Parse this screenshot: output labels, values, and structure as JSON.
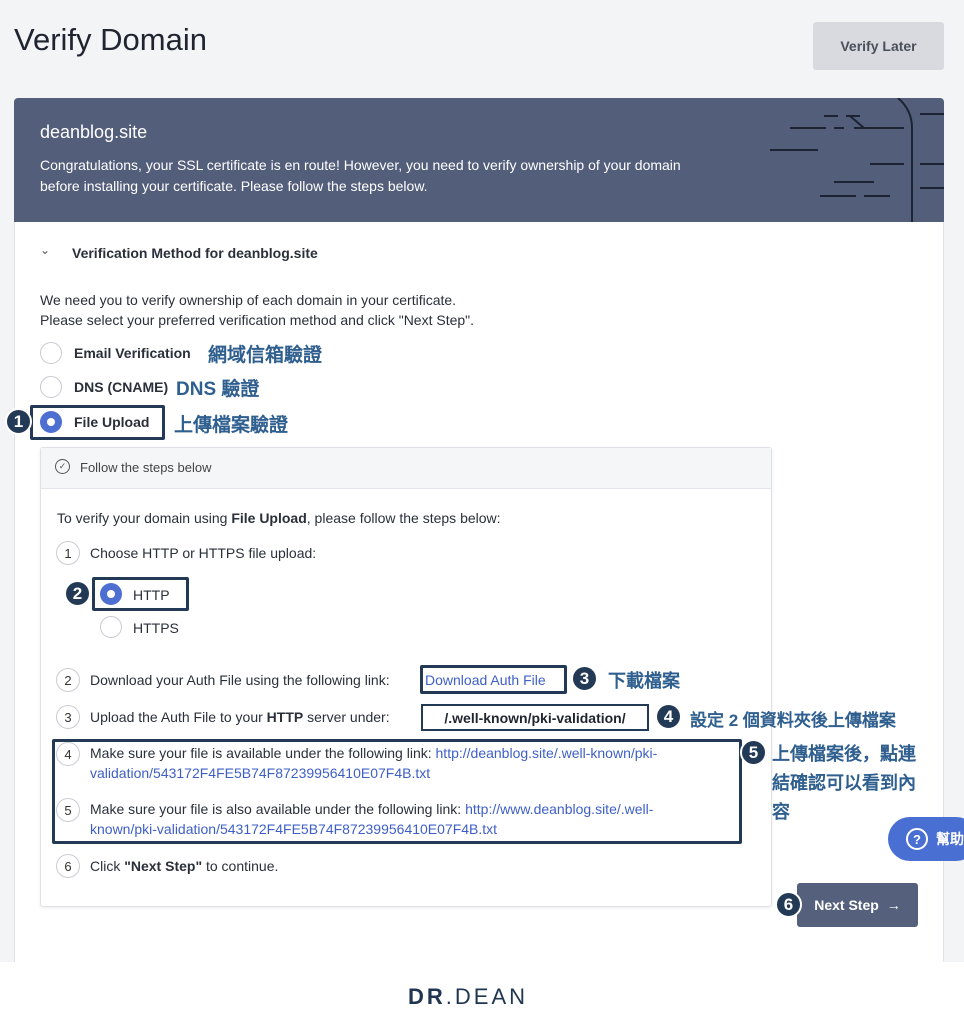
{
  "header": {
    "title": "Verify Domain",
    "verify_later": "Verify Later"
  },
  "banner": {
    "domain": "deanblog.site",
    "message": "Congratulations, your SSL certificate is en route! However, you need to verify ownership of your domain before installing your certificate. Please follow the steps below."
  },
  "method": {
    "title": "Verification Method for deanblog.site",
    "intro_line1": "We need you to verify ownership of each domain in your certificate.",
    "intro_line2": "Please select your preferred verification method and click \"Next Step\".",
    "options": [
      {
        "label": "Email Verification",
        "annotation": "網域信箱驗證",
        "selected": false
      },
      {
        "label": "DNS (CNAME)",
        "annotation": "DNS 驗證",
        "selected": false
      },
      {
        "label": "File Upload",
        "annotation": "上傳檔案驗證",
        "selected": true
      }
    ]
  },
  "steps": {
    "header": "Follow the steps below",
    "intro_prefix": "To verify your domain using ",
    "intro_bold": "File Upload",
    "intro_suffix": ", please follow the steps below:",
    "step1": {
      "num": "1",
      "text": "Choose HTTP or HTTPS file upload:",
      "http": "HTTP",
      "https": "HTTPS"
    },
    "step2": {
      "num": "2",
      "text": "Download your Auth File using the following link:",
      "link": "Download Auth File",
      "annotation": "下載檔案"
    },
    "step3": {
      "num": "3",
      "prefix": "Upload the Auth File to your ",
      "bold": "HTTP",
      "suffix": " server under:",
      "path": "/.well-known/pki-validation/",
      "annotation": "設定 2 個資料夾後上傳檔案"
    },
    "step4": {
      "num": "4",
      "text": "Make sure your file is available under the following link:",
      "link_a": "http://deanblog.site/.well-known/pki-",
      "link_b": "validation/543172F4FE5B74F87239956410E07F4B.txt"
    },
    "step5": {
      "num": "5",
      "text": "Make sure your file is also available under the following link:",
      "link_a": "http://www.deanblog.site/.well-",
      "link_b": "known/pki-validation/543172F4FE5B74F87239956410E07F4B.txt"
    },
    "step6": {
      "num": "6",
      "prefix": "Click ",
      "bold": "\"Next Step\"",
      "suffix": " to continue."
    },
    "annotation5_line1": "上傳檔案後，點連",
    "annotation5_line2": "結確認可以看到內",
    "annotation5_line3": "容"
  },
  "badges": [
    "1",
    "2",
    "3",
    "4",
    "5",
    "6"
  ],
  "next_step": "Next Step",
  "help": {
    "label": "幫助",
    "icon": "?"
  },
  "logo": {
    "part1": "DR",
    "part2": ".DEAN"
  }
}
